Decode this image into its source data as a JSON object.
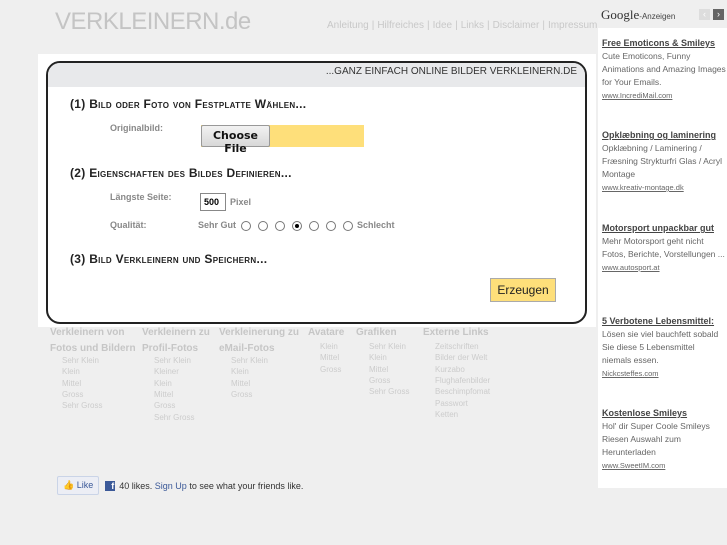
{
  "header": {
    "logo": "VERKLEINERN.de",
    "nav": [
      "Anleitung",
      "Hilfreiches",
      "Idee",
      "Links",
      "Disclaimer",
      "Impressum"
    ]
  },
  "main": {
    "tagline": "...GANZ EINFACH ONLINE BILDER VERKLEINERN.DE",
    "step1": "(1) Bild oder Foto von Festplatte Wählen...",
    "original_label": "Originalbild:",
    "choose_file": "Choose File",
    "step2": "(2) Eigenschaften des Bildes Definieren...",
    "size_label": "Längste Seite:",
    "size_value": "500",
    "size_unit": "Pixel",
    "quality_label": "Qualität:",
    "quality_best": "Sehr Gut",
    "quality_worst": "Schlecht",
    "quality_selected_index": 3,
    "step3": "(3) Bild Verkleinern und Speichern...",
    "submit": "Erzeugen"
  },
  "footer": {
    "columns": [
      {
        "title": "Verkleinern von Fotos und Bildern",
        "items": [
          "Sehr Klein",
          "Klein",
          "Mittel",
          "Gross",
          "Sehr Gross"
        ]
      },
      {
        "title": "Verkleinern zu Profil-Fotos",
        "items": [
          "Sehr Klein",
          "Kleiner",
          "Klein",
          "Mittel",
          "Gross",
          "Sehr Gross"
        ]
      },
      {
        "title": "Verkleinerung zu eMail-Fotos",
        "items": [
          "Sehr Klein",
          "Klein",
          "Mittel",
          "Gross"
        ]
      },
      {
        "title": "Avatare",
        "items": [
          "Klein",
          "Mittel",
          "Gross"
        ]
      },
      {
        "title": "Grafiken",
        "items": [
          "Sehr Klein",
          "Klein",
          "Mittel",
          "Gross",
          "Sehr Gross"
        ]
      },
      {
        "title": "Externe Links",
        "items": [
          "Zeitschriften",
          "Bilder der Welt",
          "Kurzabo",
          "Flughafenbilder",
          "Beschimpfomat",
          "Passwort",
          "Ketten"
        ]
      }
    ]
  },
  "facebook": {
    "like": "Like",
    "count": "40 likes.",
    "signup": "Sign Up",
    "rest": "to see what your friends like."
  },
  "ads": {
    "brand": "Google",
    "label": "-Anzeigen",
    "items": [
      {
        "title": "Free Emoticons & Smileys",
        "text": "Cute Emoticons, Funny Animations and Amazing Images for Your Emails.",
        "url": "www.IncrediMail.com"
      },
      {
        "title": "Opklæbning og laminering",
        "text": "Opklæbning / Laminering / Fræsning Strykturfri Glas / Acryl Montage",
        "url": "www.kreativ-montage.dk"
      },
      {
        "title": "Motorsport unpackbar gut",
        "text": "Mehr Motorsport geht nicht Fotos, Berichte, Vorstellungen ...",
        "url": "www.autosport.at"
      },
      {
        "title": "5 Verbotene Lebensmittel:",
        "text": "Lösen sie viel bauchfett sobald Sie diese 5 Lebensmittel niemals essen.",
        "url": "Nickcsteffes.com"
      },
      {
        "title": "Kostenlose Smileys",
        "text": "Hol' dir Super Coole Smileys Riesen Auswahl zum Herunterladen",
        "url": "www.SweetIM.com"
      }
    ]
  }
}
